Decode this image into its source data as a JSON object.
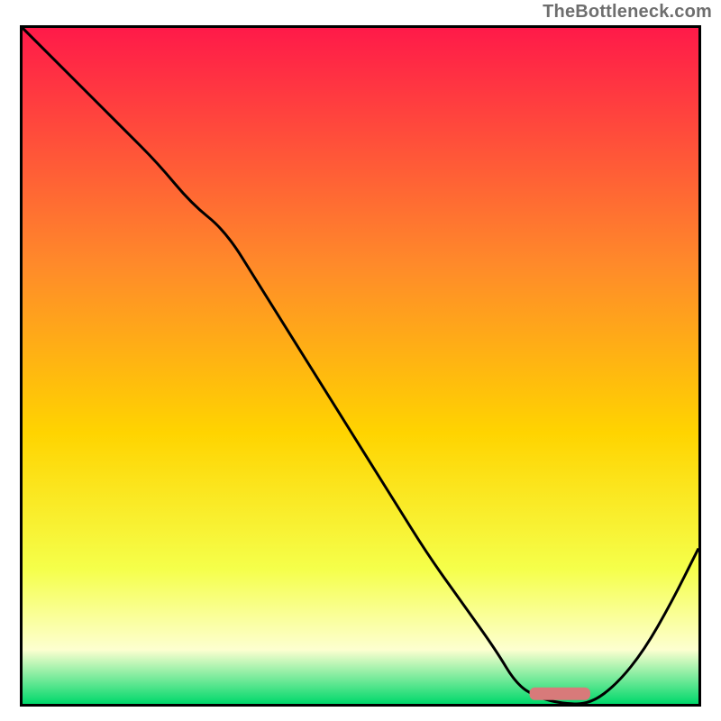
{
  "watermark": "TheBottleneck.com",
  "colors": {
    "gradient_top": "#ff1a49",
    "gradient_mid1": "#ff8a2a",
    "gradient_mid2": "#ffd400",
    "gradient_mid3": "#f5ff4a",
    "gradient_mid4": "#fdffd0",
    "gradient_bottom": "#00d86b",
    "curve": "#000000",
    "marker": "#d87a7a",
    "frame": "#000000"
  },
  "chart_data": {
    "type": "line",
    "title": "",
    "xlabel": "",
    "ylabel": "",
    "xlim": [
      0,
      100
    ],
    "ylim": [
      0,
      100
    ],
    "grid": false,
    "legend": false,
    "series": [
      {
        "name": "bottleneck-curve",
        "x": [
          0,
          5,
          10,
          15,
          20,
          25,
          30,
          35,
          40,
          45,
          50,
          55,
          60,
          65,
          70,
          73,
          76,
          80,
          84,
          88,
          92,
          96,
          100
        ],
        "y": [
          100,
          95,
          90,
          85,
          80,
          74,
          70,
          62,
          54,
          46,
          38,
          30,
          22,
          15,
          8,
          3,
          1,
          0,
          0,
          3,
          8,
          15,
          23
        ]
      }
    ],
    "marker": {
      "x_start": 75,
      "x_end": 84,
      "y": 1.5
    },
    "background_gradient_stops": [
      {
        "offset": 0.0,
        "hex": "#ff1a49"
      },
      {
        "offset": 0.35,
        "hex": "#ff8a2a"
      },
      {
        "offset": 0.6,
        "hex": "#ffd400"
      },
      {
        "offset": 0.8,
        "hex": "#f5ff4a"
      },
      {
        "offset": 0.92,
        "hex": "#fdffd0"
      },
      {
        "offset": 1.0,
        "hex": "#00d86b"
      }
    ]
  }
}
